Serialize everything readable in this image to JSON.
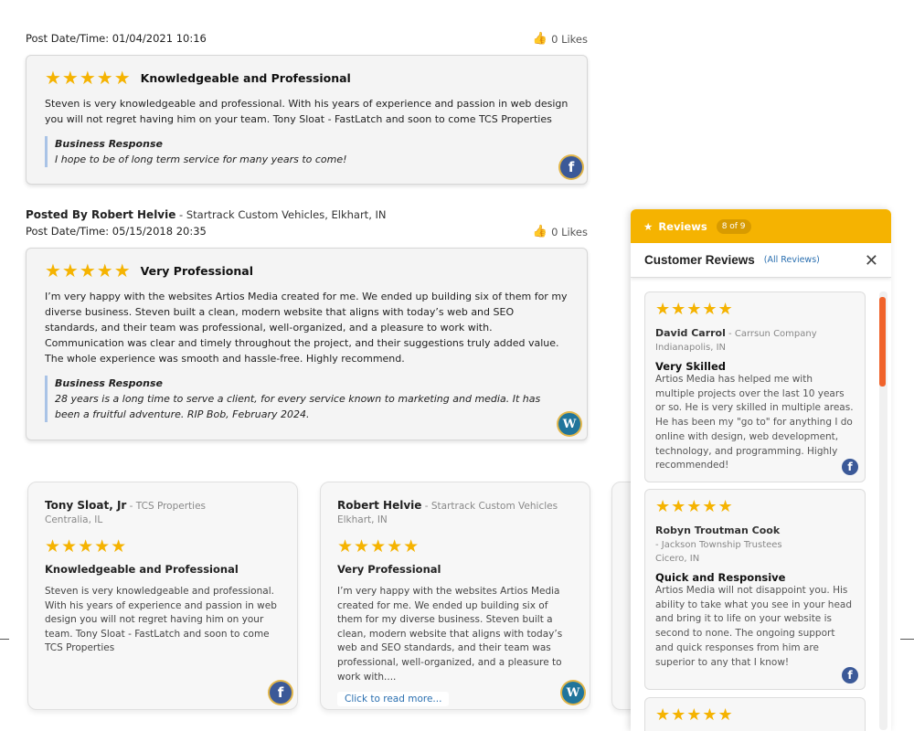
{
  "review1": {
    "date": "Post Date/Time: 01/04/2021 10:16",
    "likes": "0 Likes",
    "stars": "★★★★★",
    "title": "Knowledgeable and Professional",
    "body": "Steven is very knowledgeable and professional. With his years of experience and passion in web design you will not regret having him on your team. Tony Sloat - FastLatch and soon to come TCS Properties",
    "response_label": "Business Response",
    "response": "I hope to be of long term service for many years to come!",
    "source_icon": "facebook-icon"
  },
  "review2": {
    "posted_by_label": "Posted By Robert Helvie",
    "posted_by_sub": " - Startrack Custom Vehicles, Elkhart, IN",
    "date": "Post Date/Time: 05/15/2018 20:35",
    "likes": "0 Likes",
    "stars": "★★★★★",
    "title": "Very Professional",
    "body": "I’m very happy with the websites Artios Media created for me. We ended up building six of them for my diverse business. Steven built a clean, modern website that aligns with today’s web and SEO standards, and their team was professional, well-organized, and a pleasure to work with. Communication was clear and timely throughout the project, and their suggestions truly added value. The whole experience was smooth and hassle-free. Highly recommend.",
    "response_label": "Business Response",
    "response": "28 years is a long time to serve a client, for every service known to marketing and media. It has been a fruitful adventure. RIP Bob, February 2024.",
    "source_icon": "wordpress-icon"
  },
  "cards": [
    {
      "name": "Tony Sloat, Jr",
      "company": " - TCS Properties",
      "location": "Centralia, IL",
      "stars": "★★★★★",
      "title": "Knowledgeable and Professional",
      "text": "Steven is very knowledgeable and professional. With his years of experience and passion in web design you will not regret having him on your team. Tony Sloat - FastLatch and soon to come TCS Properties",
      "source_icon": "facebook-icon"
    },
    {
      "name": "Robert Helvie",
      "company": " - Startrack Custom Vehicles",
      "location": "Elkhart, IN",
      "stars": "★★★★★",
      "title": "Very Professional",
      "text": "I’m very happy with the websites Artios Media created for me. We ended up building six of them for my diverse business. Steven built a clean, modern website that aligns with today’s web and SEO standards, and their team was professional, well-organized, and a pleasure to work with....",
      "read_more": "Click to read more...",
      "source_icon": "wordpress-icon"
    }
  ],
  "widget": {
    "tab_label": "Reviews",
    "counter": "8 of 9",
    "title": "Customer Reviews",
    "all_link": "(All Reviews)",
    "close": "✕",
    "items": [
      {
        "stars": "★★★★★",
        "name": "David Carrol",
        "company": " - Carrsun Company",
        "location": "Indianapolis, IN",
        "title": "Very Skilled",
        "text": "Artios Media has helped me with multiple projects over the last 10 years or so. He is very skilled in multiple areas. He has been my \"go to\" for anything I do online with design, web development, technology, and programming. Highly recommended!",
        "source_icon": "facebook-icon"
      },
      {
        "stars": "★★★★★",
        "name": "Robyn Troutman Cook",
        "company": " - Jackson Township Trustees",
        "location": "Cicero, IN",
        "title": "Quick and Responsive",
        "text": "Artios Media will not disappoint you. His ability to take what you see in your head and bring it to life on your website is second to none. The ongoing support and quick responses from him are superior to any that I know!",
        "source_icon": "facebook-icon"
      },
      {
        "stars": "★★★★★"
      }
    ]
  },
  "colors": {
    "star": "#f5b301",
    "widget_tab": "#f5b301",
    "scroll_thumb": "#f0632b",
    "link": "#2a6fb0"
  }
}
